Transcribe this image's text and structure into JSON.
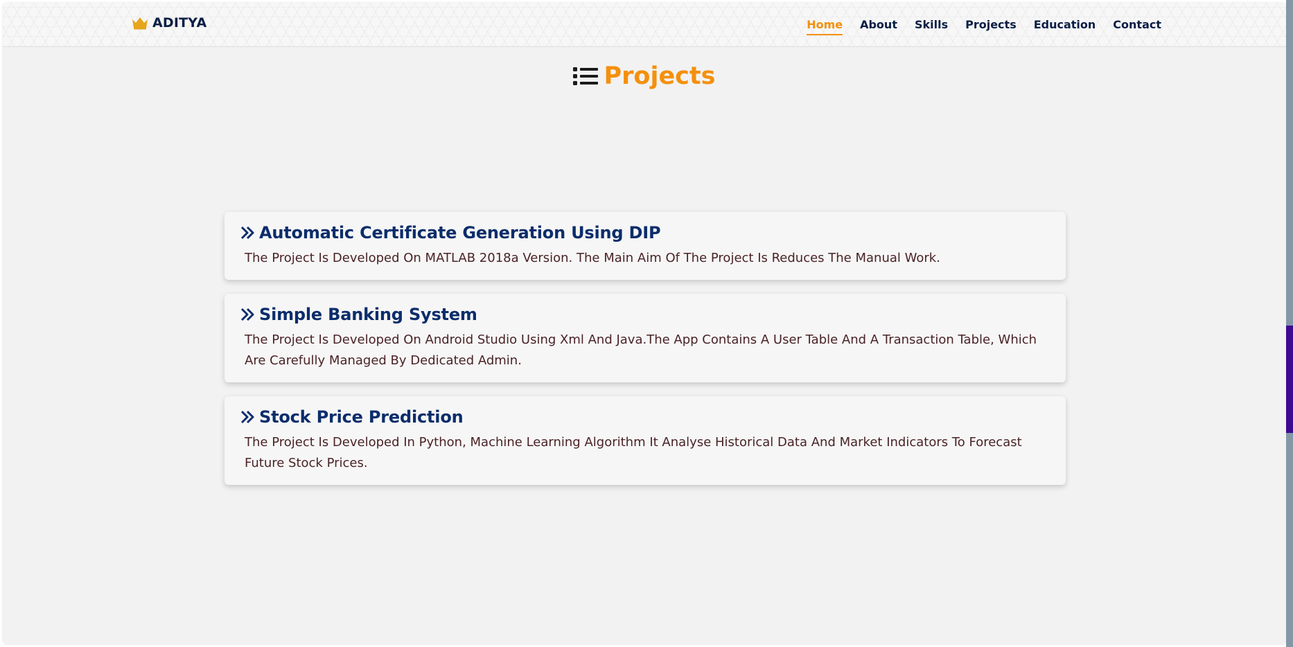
{
  "header": {
    "logo_text": "ADITYA",
    "logo_icon": "crown-icon",
    "nav": [
      {
        "label": "Home",
        "active": true
      },
      {
        "label": "About",
        "active": false
      },
      {
        "label": "Skills",
        "active": false
      },
      {
        "label": "Projects",
        "active": false
      },
      {
        "label": "Education",
        "active": false
      },
      {
        "label": "Contact",
        "active": false
      }
    ]
  },
  "section": {
    "title": "Projects",
    "icon": "list-icon"
  },
  "projects": [
    {
      "title": "Automatic Certificate Generation Using DIP",
      "description": "The Project Is Developed On MATLAB 2018a Version. The Main Aim Of The Project Is Reduces The Manual Work."
    },
    {
      "title": "Simple Banking System",
      "description": "The Project Is Developed On Android Studio Using Xml And Java.The App Contains A User Table And A Transaction Table, Which Are Carefully Managed By Dedicated Admin."
    },
    {
      "title": "Stock Price Prediction",
      "description": "The Project Is Developed In Python, Machine Learning Algorithm It Analyse Historical Data And Market Indicators To Forecast Future Stock Prices."
    }
  ],
  "colors": {
    "accent": "#f4900c",
    "navy": "#0b1e45",
    "card_title": "#0b2d6b",
    "card_text": "#4a2326",
    "scroll_thumb": "#3d0a91"
  }
}
